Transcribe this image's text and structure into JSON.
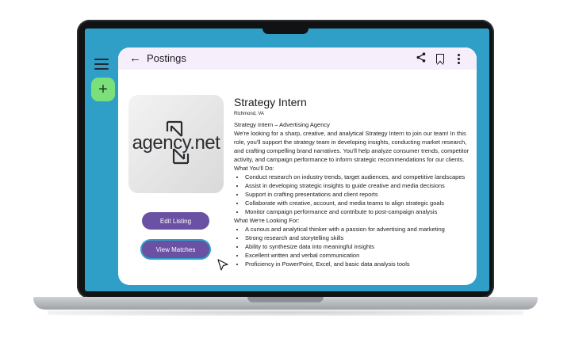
{
  "app": {
    "title": "Postings",
    "back_icon": "arrow-left-icon",
    "actions": [
      "share-icon",
      "bookmark-icon",
      "more-vert-icon"
    ]
  },
  "rail": {
    "menu_icon": "hamburger-menu-icon",
    "fab_label": "+",
    "fab_color": "#7be07a"
  },
  "logo": {
    "text": "agency.net"
  },
  "buttons": {
    "edit": "Edit Listing",
    "view": "View Matches"
  },
  "job": {
    "title": "Strategy Intern",
    "location": "Richmond, VA",
    "heading": "Strategy Intern – Advertising Agency",
    "intro": "We're looking for a sharp, creative, and analytical Strategy Intern to join our team! In this role, you'll support the strategy team in developing insights, conducting market research, and crafting compelling brand narratives. You'll help analyze consumer trends, competitor activity, and campaign performance to inform strategic recommendations for our clients.",
    "section1": "What You'll Do:",
    "duties": [
      "Conduct research on industry trends, target audiences, and competitive landscapes",
      "Assist in developing strategic insights to guide creative and media decisions",
      "Support in crafting presentations and client reports",
      "Collaborate with creative, account, and media teams to align strategic goals",
      "Monitor campaign performance and contribute to post-campaign analysis"
    ],
    "section2": "What We're Looking For:",
    "requirements": [
      "A curious and analytical thinker with a passion for advertising and marketing",
      "Strong research and storytelling skills",
      "Ability to synthesize data into meaningful insights",
      "Excellent written and verbal communication",
      "Proficiency in PowerPoint, Excel, and basic data analysis tools"
    ]
  },
  "colors": {
    "accent": "#6a51a3",
    "screen_bg": "#2f9fc8",
    "appbar_bg": "#f6effb"
  }
}
